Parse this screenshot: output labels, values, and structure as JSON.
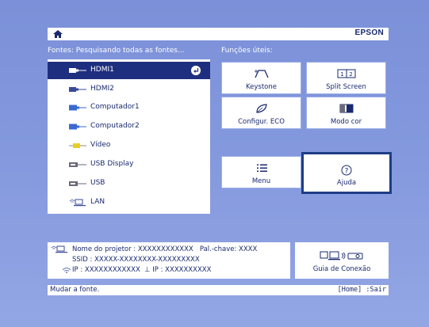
{
  "brand": "EPSON",
  "sources": {
    "header": "Fontes: Pesquisando todas as fontes...",
    "items": [
      {
        "label": "HDMI1",
        "icon": "hdmi-icon",
        "selected": true
      },
      {
        "label": "HDMI2",
        "icon": "hdmi-icon"
      },
      {
        "label": "Computador1",
        "icon": "vga-icon"
      },
      {
        "label": "Computador2",
        "icon": "vga-icon"
      },
      {
        "label": "Vídeo",
        "icon": "video-icon"
      },
      {
        "label": "USB Display",
        "icon": "usb-icon"
      },
      {
        "label": "USB",
        "icon": "usb-icon"
      },
      {
        "label": "LAN",
        "icon": "lan-icon"
      }
    ]
  },
  "functions": {
    "header": "Funções úteis:",
    "keystone": "Keystone",
    "split": "Split Screen",
    "split_nums": [
      "1",
      "2"
    ],
    "eco": "Configur. ECO",
    "color": "Modo cor",
    "menu": "Menu",
    "help": "Ajuda",
    "help_glyph": "?"
  },
  "info": {
    "line1": "Nome do projetor : XXXXXXXXXXXX   Pal.-chave: XXXX",
    "line2": "SSID : XXXXX-XXXXXXXX-XXXXXXXXX",
    "line3": "IP : XXXXXXXXXXXX  ⊥ IP : XXXXXXXXXX"
  },
  "guide": "Guia de Conexão",
  "status": {
    "left": "Mudar a fonte.",
    "right": "[Home] :Sair"
  },
  "colors": {
    "background": "#8397dc",
    "selection": "#1f2f7f",
    "text": "#1a2a6e",
    "focus_border": "#1e3d86"
  }
}
